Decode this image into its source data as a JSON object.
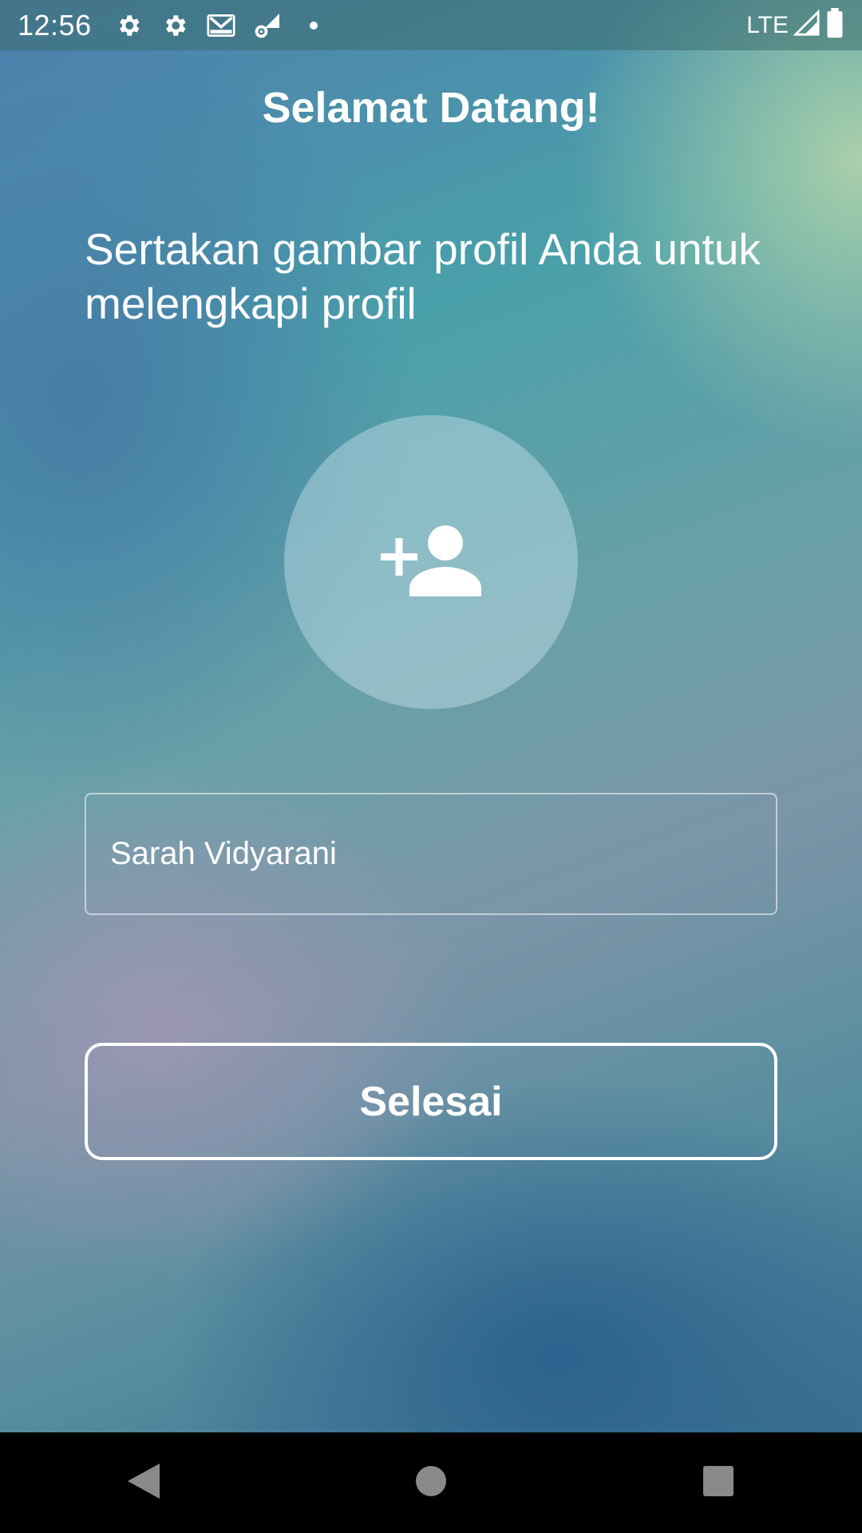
{
  "status_bar": {
    "time": "12:56",
    "network": "LTE",
    "icons": [
      "settings-icon",
      "settings-icon",
      "gmail-icon",
      "signal-settings-icon",
      "notification-dot"
    ]
  },
  "header": {
    "title": "Selamat Datang!"
  },
  "main": {
    "subtitle": "Sertakan gambar profil Anda untuk melengkapi profil",
    "avatar_icon": "add-person-icon",
    "name_input": {
      "value": "Sarah Vidyarani"
    },
    "done_button": "Selesai"
  },
  "nav_bar": {
    "buttons": [
      "back-icon",
      "home-icon",
      "recents-icon"
    ]
  }
}
